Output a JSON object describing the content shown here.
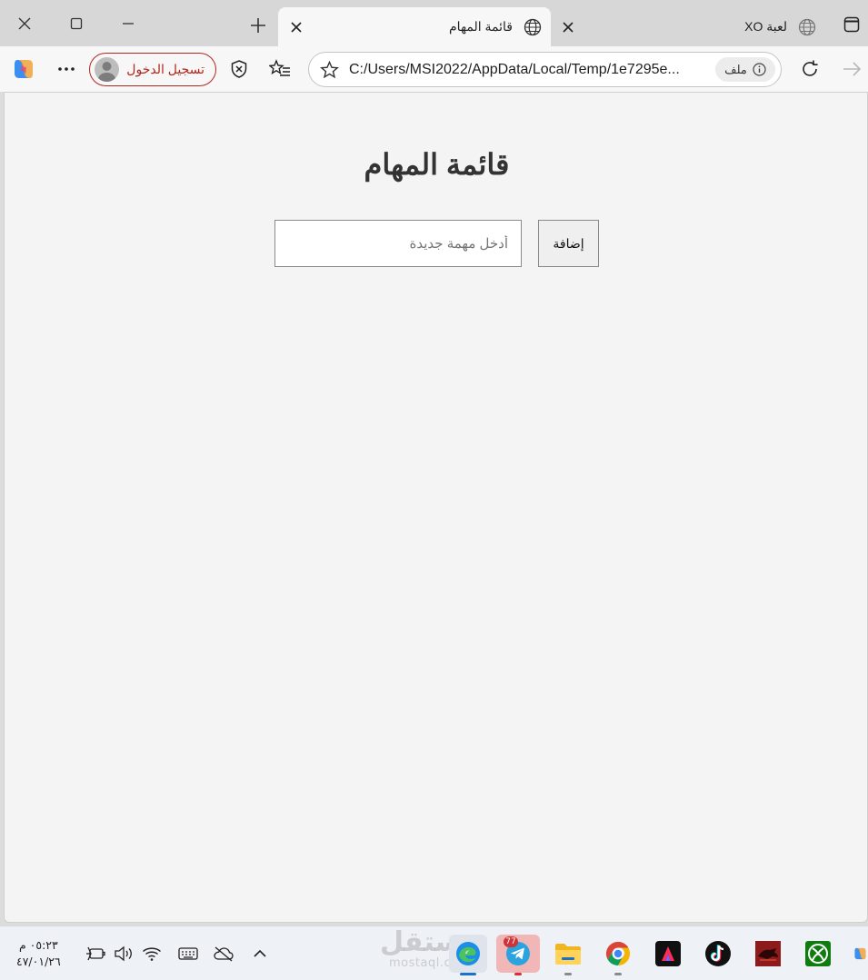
{
  "browser": {
    "tabs": [
      {
        "title": "قائمة المهام",
        "active": true
      },
      {
        "title": "لعبة XO",
        "active": false
      }
    ],
    "signin_label": "تسجيل الدخول",
    "url": "C:/Users/MSI2022/AppData/Local/Temp/1e7295e...",
    "url_chip": "ملف"
  },
  "page": {
    "title": "قائمة المهام",
    "input_placeholder": "أدخل مهمة جديدة",
    "add_button_label": "إضافة"
  },
  "taskbar": {
    "time": "٠٥:٢٣ م",
    "date": "٤٧/٠١/٢٦",
    "telegram_badge": "77",
    "watermark_ar": "مستقل",
    "watermark_en": "mostaql.com",
    "apps": [
      "edge-icon",
      "telegram-icon",
      "file-explorer-icon",
      "chrome-icon",
      "adobe-icon",
      "tiktok-icon",
      "game-icon",
      "xbox-icon",
      "copilot-icon"
    ]
  },
  "colors": {
    "signin_accent": "#b3261e",
    "page_background": "#f4f4f4",
    "title_color": "#333333",
    "edge_indicator": "#1a73c9"
  }
}
